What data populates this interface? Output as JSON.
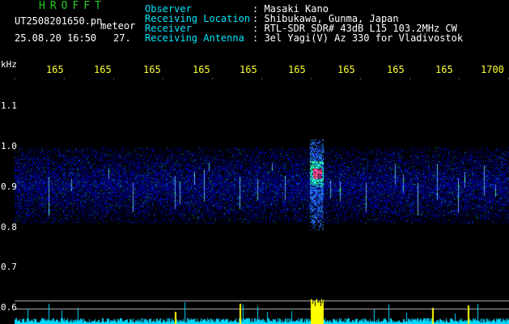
{
  "header": {
    "logo": "HROFFT",
    "filename": "UT2508201650.pn",
    "mode": "meteor",
    "datetime": "25.08.20 16:50",
    "count": "27.",
    "info_labels": [
      "Observer",
      "Receiving Location",
      "Receiver",
      "Receiving Antenna"
    ],
    "info_values": [
      ": Masaki Kano",
      ": Shibukawa, Gunma, Japan",
      ": RTL-SDR SDR# 43dB L15 103.2MHz CW",
      ": 3el Yagi(V) Az 330 for Vladivostok"
    ]
  },
  "axis": {
    "unit": "kHz",
    "x_ticks": [
      "165",
      "165",
      "165",
      "165",
      "165",
      "165",
      "165",
      "165",
      "165",
      "1700"
    ],
    "y_ticks": [
      "1.1",
      "1.0",
      "0.9",
      "0.8",
      "0.7",
      "0.6"
    ]
  },
  "colors": {
    "label": "#00e5ff",
    "value": "#ffffff",
    "tick_x": "#ffff33",
    "logo": "#22cc22",
    "spectrum": "#00e5ff",
    "peak": "#ffff33"
  }
}
